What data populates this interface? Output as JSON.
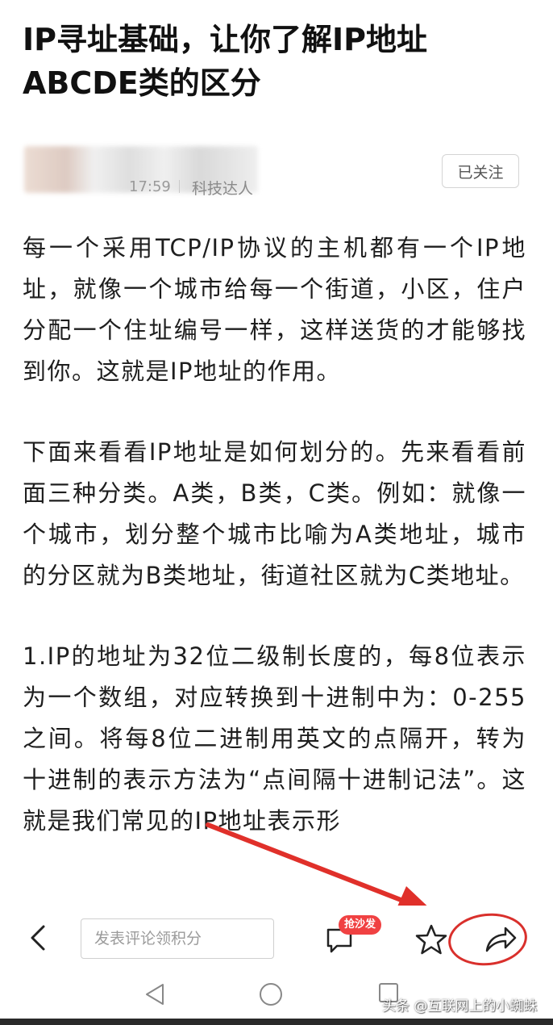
{
  "article": {
    "title": "IP寻址基础，让你了解IP地址ABCDE类的区分",
    "author_time": "17:59",
    "author_tag": "科技达人",
    "follow_label": "已关注",
    "paragraphs": [
      "每一个采用TCP/IP协议的主机都有一个IP地址，就像一个城市给每一个街道，小区，住户分配一个住址编号一样，这样送货的才能够找到你。这就是IP地址的作用。",
      "下面来看看IP地址是如何划分的。先来看看前面三种分类。A类，B类，C类。例如：就像一个城市，划分整个城市比喻为A类地址，城市的分区就为B类地址，街道社区就为C类地址。",
      "1.IP的地址为32位二级制长度的，每8位表示为一个数组，对应转换到十进制中为：0-255之间。将每8位二进制用英文的点隔开，转为十进制的表示方法为“点间隔十进制记法”。这就是我们常见的IP地址表示形"
    ]
  },
  "bottom_bar": {
    "back_icon": "chevron-left-icon",
    "comment_placeholder": "发表评论领积分",
    "comment_icon": "comment-bubble-icon",
    "sofa_badge": "抢沙发",
    "favorite_icon": "star-outline-icon",
    "share_icon": "share-arrow-icon",
    "annotation_color": "#d9302c"
  },
  "system_nav": {
    "back_icon": "triangle-back-icon",
    "home_icon": "circle-home-icon",
    "recent_icon": "square-recent-icon"
  },
  "watermark": "头条 @互联网上的小蜘蛛"
}
